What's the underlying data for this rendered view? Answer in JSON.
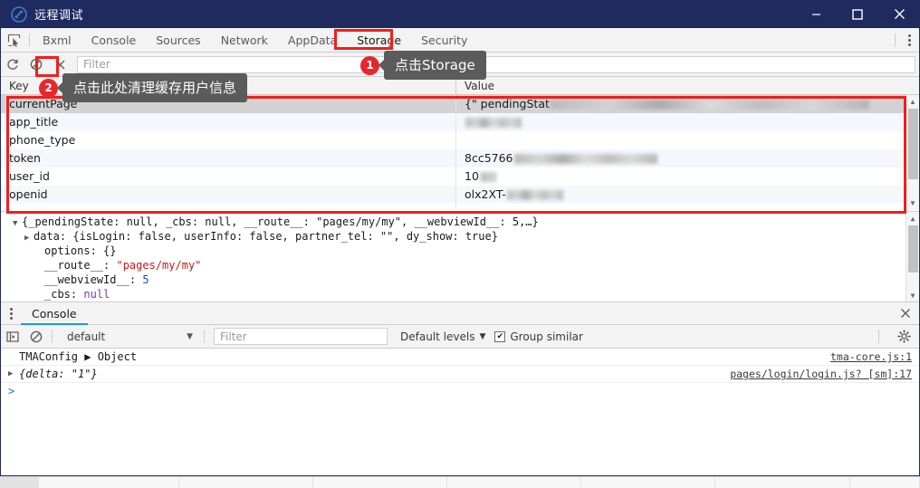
{
  "window": {
    "title": "远程调试",
    "logo_icon": "app-logo-icon",
    "minimize_label": "—",
    "maximize_label": "□",
    "close_label": "✕"
  },
  "devtools": {
    "inspect_icon": "inspect-element-icon",
    "tabs": [
      {
        "label": "Bxml",
        "active": false
      },
      {
        "label": "Console",
        "active": false
      },
      {
        "label": "Sources",
        "active": false
      },
      {
        "label": "Network",
        "active": false
      },
      {
        "label": "AppData",
        "active": false
      },
      {
        "label": "Storage",
        "active": true
      },
      {
        "label": "Security",
        "active": false
      }
    ],
    "more_icon": "kebab-menu-icon"
  },
  "storage_toolbar": {
    "refresh_icon": "refresh-icon",
    "clear_all_icon": "clear-all-icon",
    "delete_icon": "delete-selected-icon",
    "filter_placeholder": "Filter"
  },
  "kv_table": {
    "columns": [
      "Key",
      "Value"
    ],
    "rows": [
      {
        "key": "currentPage",
        "value_prefix": "{\" pendingStat",
        "redacted": true,
        "redact_width": 352,
        "selected": true
      },
      {
        "key": "app_title",
        "value_prefix": "",
        "redacted": true,
        "redact_width": 62,
        "selected": false
      },
      {
        "key": "phone_type",
        "value_prefix": "",
        "redacted": false,
        "redact_width": 0,
        "selected": false
      },
      {
        "key": "token",
        "value_prefix": "8cc5766",
        "redacted": true,
        "redact_width": 158,
        "selected": false
      },
      {
        "key": "user_id",
        "value_prefix": "10",
        "redacted": true,
        "redact_width": 18,
        "selected": false
      },
      {
        "key": "openid",
        "value_prefix": "olx2XT-",
        "redacted": true,
        "redact_width": 62,
        "selected": false
      }
    ]
  },
  "json_preview": {
    "lines": [
      {
        "indent": 0,
        "triangle": "▼",
        "text": "{_pendingState: null, _cbs: null, __route__: \"pages/my/my\", __webviewId__: 5,…}"
      },
      {
        "indent": 1,
        "triangle": "▶",
        "key": "data: ",
        "text": "{isLogin: false, userInfo: false, partner_tel: \"\", dy_show: true}"
      },
      {
        "indent": 2,
        "triangle": "",
        "key": "options: ",
        "text": "{}"
      },
      {
        "indent": 2,
        "triangle": "",
        "key": "__route__: ",
        "text": "\"pages/my/my\"",
        "type": "string"
      },
      {
        "indent": 2,
        "triangle": "",
        "key": "__webviewId__: ",
        "text": "5",
        "type": "number"
      },
      {
        "indent": 2,
        "triangle": "",
        "key": "_cbs: ",
        "text": "null",
        "type": "null"
      }
    ]
  },
  "console": {
    "drawer_menu_icon": "kebab-menu-icon",
    "tab_label": "Console",
    "close_icon": "close-icon",
    "execute_icon": "execution-context-icon",
    "clear_icon": "clear-console-icon",
    "context_value": "default",
    "context_caret": "▼",
    "filter_placeholder": "Filter",
    "levels_label": "Default levels",
    "levels_caret": "▼",
    "group_similar_label": "Group similar",
    "group_similar_checked": true,
    "checkmark": "✔",
    "settings_icon": "gear-icon",
    "messages": [
      {
        "triangle": "",
        "text": "TMAConfig ▶ Object",
        "source": "tma-core.js:1"
      },
      {
        "triangle": "▶",
        "text": "{delta: \"1\"}",
        "source": "pages/login/login.js? [sm]:17"
      }
    ],
    "prompt_symbol": ">"
  },
  "callouts": [
    {
      "number": "1",
      "text": "点击Storage"
    },
    {
      "number": "2",
      "text": "点击此处清理缓存用户信息"
    }
  ],
  "colors": {
    "titlebar": "#1f2a5e",
    "highlight_red": "#f01e1e",
    "badge_red": "#e8272c",
    "tooltip_gray": "#5b5b5b",
    "accent_blue": "#1a9ae0"
  }
}
